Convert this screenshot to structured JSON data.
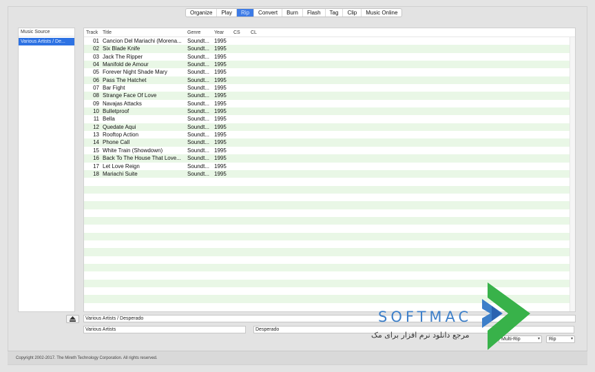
{
  "toolbar": {
    "tabs": [
      {
        "label": "Organize"
      },
      {
        "label": "Play"
      },
      {
        "label": "Rip",
        "active": true
      },
      {
        "label": "Convert"
      },
      {
        "label": "Burn"
      },
      {
        "label": "Flash"
      },
      {
        "label": "Tag"
      },
      {
        "label": "Clip"
      },
      {
        "label": "Music Online"
      }
    ]
  },
  "sidebar": {
    "header": "Music Source",
    "items": [
      {
        "label": "Various Artists / De..."
      }
    ]
  },
  "table": {
    "columns": {
      "track": "Track",
      "title": "Title",
      "genre": "Genre",
      "year": "Year",
      "cs": "CS",
      "cl": "CL"
    },
    "rows": [
      {
        "track": "01",
        "title": "Cancion Del Mariachi (Morena...",
        "genre": "Soundt...",
        "year": "1995"
      },
      {
        "track": "02",
        "title": "Six Blade Knife",
        "genre": "Soundt...",
        "year": "1995"
      },
      {
        "track": "03",
        "title": "Jack The Ripper",
        "genre": "Soundt...",
        "year": "1995"
      },
      {
        "track": "04",
        "title": "Manifold de Amour",
        "genre": "Soundt...",
        "year": "1995"
      },
      {
        "track": "05",
        "title": "Forever Night Shade Mary",
        "genre": "Soundt...",
        "year": "1995"
      },
      {
        "track": "06",
        "title": "Pass The Hatchet",
        "genre": "Soundt...",
        "year": "1995"
      },
      {
        "track": "07",
        "title": "Bar Fight",
        "genre": "Soundt...",
        "year": "1995"
      },
      {
        "track": "08",
        "title": "Strange Face Of Love",
        "genre": "Soundt...",
        "year": "1995"
      },
      {
        "track": "09",
        "title": "Navajas Attacks",
        "genre": "Soundt...",
        "year": "1995"
      },
      {
        "track": "10",
        "title": "Bulletproof",
        "genre": "Soundt...",
        "year": "1995"
      },
      {
        "track": "11",
        "title": "Bella",
        "genre": "Soundt...",
        "year": "1995"
      },
      {
        "track": "12",
        "title": "Quedate Aqui",
        "genre": "Soundt...",
        "year": "1995"
      },
      {
        "track": "13",
        "title": "Rooftop Action",
        "genre": "Soundt...",
        "year": "1995"
      },
      {
        "track": "14",
        "title": "Phone Call",
        "genre": "Soundt...",
        "year": "1995"
      },
      {
        "track": "15",
        "title": "White Train (Showdown)",
        "genre": "Soundt...",
        "year": "1995"
      },
      {
        "track": "16",
        "title": "Back To The House That Love...",
        "genre": "Soundt...",
        "year": "1995"
      },
      {
        "track": "17",
        "title": "Let Love Reign",
        "genre": "Soundt...",
        "year": "1995"
      },
      {
        "track": "18",
        "title": "Mariachi Suite",
        "genre": "Soundt...",
        "year": "1995"
      }
    ]
  },
  "bottom": {
    "album_field": "Various Artists / Desperado",
    "artist_field": "Various Artists",
    "album_name_field": "Desperado",
    "mode_select": "Multi-Rip",
    "action_select": "Rip"
  },
  "footer": {
    "copyright": "Copyright 2002-2017. The Mireth Technology Corporation. All rights reserved."
  },
  "watermark": {
    "brand": "SOFTMAC",
    "tagline": "مرجع دانلود نرم افزار برای مک"
  },
  "colors": {
    "accent": "#2d72e3",
    "row_alt": "#e9f7e6",
    "watermark_blue": "#3d7fc9",
    "watermark_green": "#38b24a"
  }
}
